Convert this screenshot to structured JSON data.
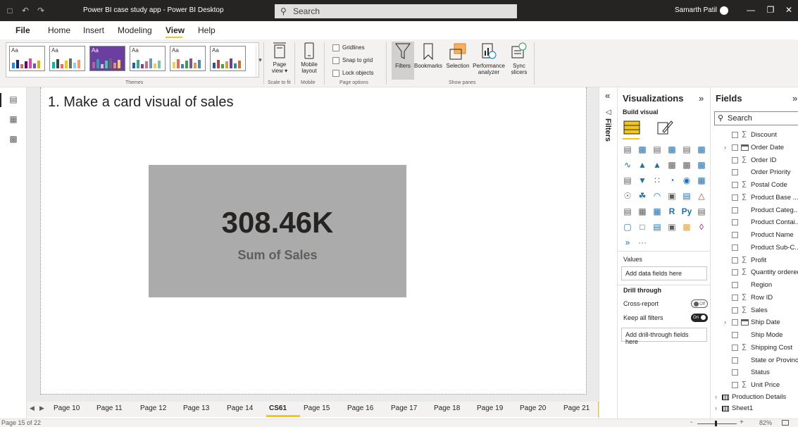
{
  "titlebar": {
    "app_title": "Power BI case study app - Power BI Desktop",
    "search_placeholder": "Search",
    "user_name": "Samarth Patil",
    "minimize": "—",
    "restore": "❐",
    "close": "✕"
  },
  "menu": {
    "file": "File",
    "home": "Home",
    "insert": "Insert",
    "modeling": "Modeling",
    "view": "View",
    "help": "Help"
  },
  "ribbon": {
    "themes_label": "Themes",
    "theme_aa": "Aa",
    "page_view": "Page view",
    "scale_to_fit": "Scale to fit",
    "mobile_layout": "Mobile layout",
    "mobile": "Mobile",
    "gridlines": "Gridlines",
    "snap_to_grid": "Snap to grid",
    "lock_objects": "Lock objects",
    "page_options": "Page options",
    "filters": "Filters",
    "bookmarks": "Bookmarks",
    "selection": "Selection",
    "performance_analyzer": "Performance analyzer",
    "sync_slicers": "Sync slicers",
    "show_panes": "Show panes"
  },
  "canvas": {
    "heading": "1. Make a card visual of sales",
    "card_value": "308.46K",
    "card_label": "Sum of Sales"
  },
  "page_tabs": [
    "Page 10",
    "Page 11",
    "Page 12",
    "Page 13",
    "Page 14",
    "CS61",
    "Page 15",
    "Page 16",
    "Page 17",
    "Page 18",
    "Page 19",
    "Page 20",
    "Page 21"
  ],
  "active_tab": "CS61",
  "add_page": "+",
  "status": {
    "page_info": "Page 15 of 22",
    "zoom": "82%",
    "zoom_minus": "-",
    "zoom_plus": "+"
  },
  "filters_pane": {
    "label": "Filters"
  },
  "visualizations": {
    "title": "Visualizations",
    "build_visual": "Build visual",
    "values_label": "Values",
    "values_drop": "Add data fields here",
    "drill_through": "Drill through",
    "cross_report": "Cross-report",
    "cross_report_state": "Off",
    "keep_all_filters": "Keep all filters",
    "keep_all_filters_state": "On",
    "drill_drop": "Add drill-through fields here",
    "more": "···"
  },
  "fields": {
    "title": "Fields",
    "search_placeholder": "Search",
    "items": [
      {
        "name": "Discount",
        "kind": "sigma"
      },
      {
        "name": "Order Date",
        "kind": "date",
        "expand": true
      },
      {
        "name": "Order ID",
        "kind": "sigma"
      },
      {
        "name": "Order Priority",
        "kind": "text"
      },
      {
        "name": "Postal Code",
        "kind": "sigma"
      },
      {
        "name": "Product Base ...",
        "kind": "sigma"
      },
      {
        "name": "Product Categ...",
        "kind": "text"
      },
      {
        "name": "Product Contai...",
        "kind": "text"
      },
      {
        "name": "Product Name",
        "kind": "text"
      },
      {
        "name": "Product Sub-C...",
        "kind": "text"
      },
      {
        "name": "Profit",
        "kind": "sigma"
      },
      {
        "name": "Quantity ordered",
        "kind": "sigma"
      },
      {
        "name": "Region",
        "kind": "text"
      },
      {
        "name": "Row ID",
        "kind": "sigma"
      },
      {
        "name": "Sales",
        "kind": "sigma"
      },
      {
        "name": "Ship Date",
        "kind": "date",
        "expand": true
      },
      {
        "name": "Ship Mode",
        "kind": "text"
      },
      {
        "name": "Shipping Cost",
        "kind": "sigma"
      },
      {
        "name": "State or Province",
        "kind": "text"
      },
      {
        "name": "Status",
        "kind": "text"
      },
      {
        "name": "Unit Price",
        "kind": "sigma"
      }
    ],
    "tables": [
      "Production Details",
      "Sheet1"
    ]
  },
  "colors": {
    "accent": "#f2c811",
    "titlebar": "#252423",
    "card_bg": "#ababab"
  }
}
